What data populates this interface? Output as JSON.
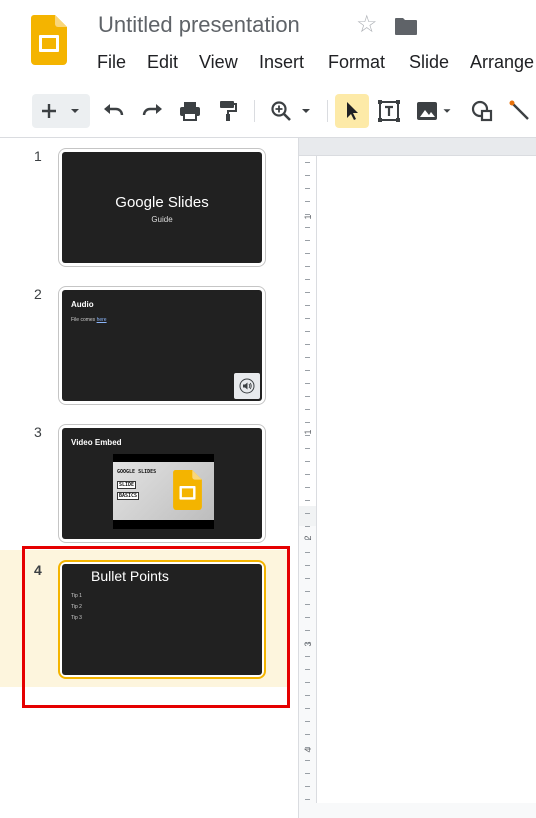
{
  "header": {
    "title": "Untitled presentation",
    "menu": [
      "File",
      "Edit",
      "View",
      "Insert",
      "Format",
      "Slide",
      "Arrange"
    ]
  },
  "toolbar": {
    "icons": [
      "new-slide-plus-icon",
      "dropdown-caret-icon",
      "undo-icon",
      "redo-icon",
      "print-icon",
      "paint-format-icon",
      "zoom-icon",
      "dropdown-caret-icon",
      "select-arrow-icon",
      "text-box-icon",
      "image-icon",
      "dropdown-caret-icon",
      "shape-icon",
      "line-icon"
    ]
  },
  "colors": {
    "accent": "#f4b400",
    "selection_row": "#fdf5dd",
    "highlight_box": "#e50000",
    "slide_bg": "#212121"
  },
  "slides": [
    {
      "number": "1",
      "title": "Google Slides",
      "subtitle": "Guide"
    },
    {
      "number": "2",
      "title": "Audio",
      "body_prefix": "File comes ",
      "body_link": "here",
      "icon": "speaker-icon"
    },
    {
      "number": "3",
      "title": "Video Embed",
      "video_text": {
        "line1": "GOOGLE SLIDES",
        "line2": "SLIDE",
        "line3": "BASICS"
      }
    },
    {
      "number": "4",
      "title": "Bullet Points",
      "tips": [
        "Tip 1",
        "Tip 2",
        "Tip 3"
      ]
    }
  ],
  "ruler": {
    "labels": [
      "1",
      "1",
      "2",
      "3",
      "4"
    ]
  }
}
